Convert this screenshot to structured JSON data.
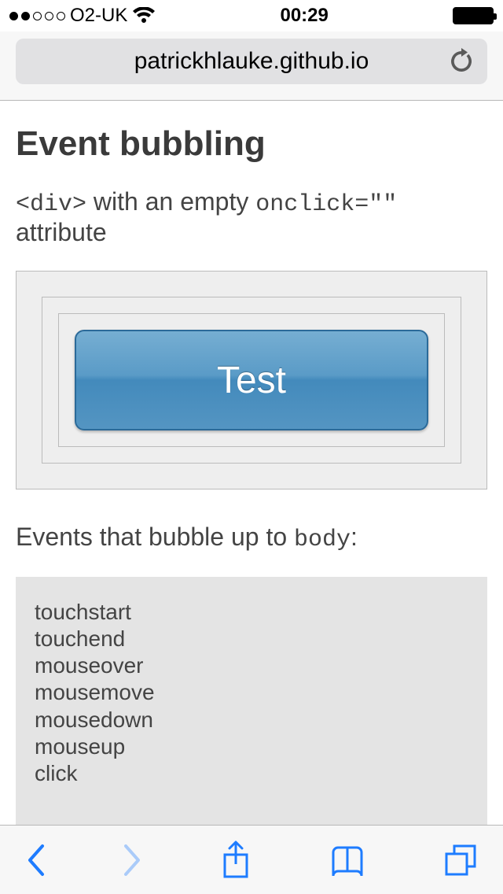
{
  "status": {
    "carrier": "O2-UK",
    "time": "00:29",
    "signal_filled": 2,
    "signal_total": 5
  },
  "browser": {
    "url": "patrickhlauke.github.io"
  },
  "page": {
    "heading": "Event bubbling",
    "subtitle_parts": {
      "code1": "<div>",
      "mid": " with an empty ",
      "code2": "onclick=\"\"",
      "end": " attribute"
    },
    "test_button_label": "Test",
    "events_label_parts": {
      "pre": "Events that bubble up to ",
      "code": "body",
      "post": ":"
    },
    "event_log": [
      "touchstart",
      "touchend",
      "mouseover",
      "mousemove",
      "mousedown",
      "mouseup",
      "click"
    ]
  },
  "colors": {
    "accent_blue": "#1e7cff"
  }
}
